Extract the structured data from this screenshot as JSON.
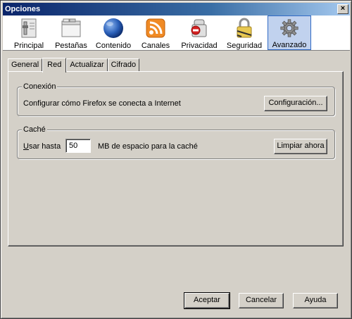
{
  "window": {
    "title": "Opciones",
    "close_glyph": "×"
  },
  "toolbar": {
    "panes": [
      {
        "label": "Principal",
        "icon": "main-switch-icon"
      },
      {
        "label": "Pestañas",
        "icon": "tabs-window-icon"
      },
      {
        "label": "Contenido",
        "icon": "globe-icon"
      },
      {
        "label": "Canales",
        "icon": "rss-feed-icon"
      },
      {
        "label": "Privacidad",
        "icon": "privacy-icon"
      },
      {
        "label": "Seguridad",
        "icon": "padlock-icon"
      },
      {
        "label": "Avanzado",
        "icon": "gear-icon"
      }
    ],
    "active_pane": "Avanzado"
  },
  "tabs": [
    {
      "label": "General"
    },
    {
      "label": "Red"
    },
    {
      "label": "Actualizar"
    },
    {
      "label": "Cifrado"
    }
  ],
  "active_tab": "Red",
  "connection": {
    "title": "Conexión",
    "description": "Configurar cómo Firefox se conecta a Internet",
    "button_label": "Configuración..."
  },
  "cache": {
    "title": "Caché",
    "use_label": "Usar hasta",
    "size_value": "50",
    "unit_label": "MB de espacio para la caché",
    "clear_button_label": "Limpiar ahora"
  },
  "footer": {
    "accept_label": "Aceptar",
    "cancel_label": "Cancelar",
    "help_label": "Ayuda"
  },
  "colors": {
    "titlebar_start": "#0a246a",
    "titlebar_end": "#a6caf0",
    "active_pane_bg": "#c1d2ee",
    "face": "#d4d0c8"
  }
}
